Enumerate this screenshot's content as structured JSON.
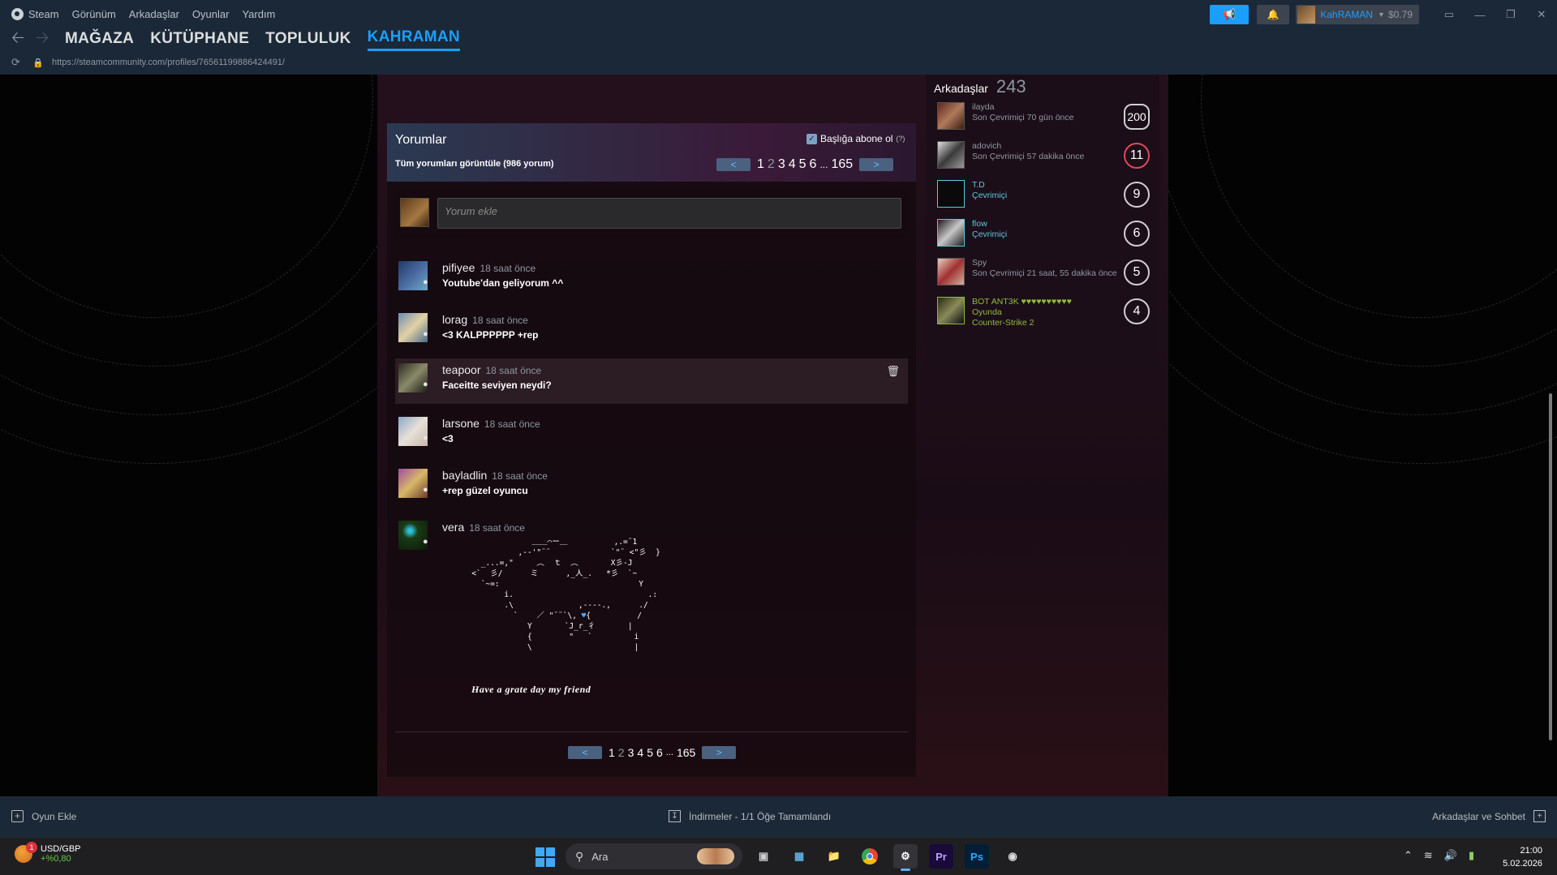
{
  "menu": {
    "steam": "Steam",
    "items": [
      "Görünüm",
      "Arkadaşlar",
      "Oyunlar",
      "Yardım"
    ]
  },
  "nav": {
    "tabs": [
      "MAĞAZA",
      "KÜTÜPHANE",
      "TOPLULUK",
      "KAHRAMAN"
    ]
  },
  "url": "https://steamcommunity.com/profiles/76561199886424491/",
  "account": {
    "name": "KahRAMAN",
    "balance": "$0.79"
  },
  "comments": {
    "title": "Yorumlar",
    "subscribe_label": "Başlığa abone ol",
    "subscribe_help": "(?)",
    "view_all": "Tüm yorumları görüntüle (986 yorum)",
    "pager": {
      "prev": "<",
      "next": ">",
      "pages": [
        "1",
        "2",
        "3",
        "4",
        "5",
        "6",
        "...",
        "165"
      ]
    },
    "add_placeholder": "Yorum ekle",
    "items": [
      {
        "author": "pifiyee",
        "time": "18 saat önce",
        "text": "Youtube'dan geliyorum ^^"
      },
      {
        "author": "lorag",
        "time": "18 saat önce",
        "text": "<3 KALPPPPPP +rep"
      },
      {
        "author": "teapoor",
        "time": "18 saat önce",
        "text": "Faceitte seviyen neydi?"
      },
      {
        "author": "larsone",
        "time": "18 saat önce",
        "text": "<3"
      },
      {
        "author": "bayladlin",
        "time": "18 saat önce",
        "text": "+rep güzel oyuncu"
      },
      {
        "author": "vera",
        "time": "18 saat önce",
        "text": "",
        "art_caption": "Have a grate day my friend"
      }
    ]
  },
  "friends": {
    "title": "Arkadaşlar",
    "count": "243",
    "items": [
      {
        "name": "ilayda",
        "status": "Son Çevrimiçi 70 gün önce",
        "game": "",
        "level": "200",
        "state": "offline"
      },
      {
        "name": "adovich",
        "status": "Son Çevrimiçi 57 dakika önce",
        "game": "",
        "level": "11",
        "state": "offline"
      },
      {
        "name": "T.D",
        "status": "Çevrimiçi",
        "game": "",
        "level": "9",
        "state": "online"
      },
      {
        "name": "flow",
        "status": "Çevrimiçi",
        "game": "",
        "level": "6",
        "state": "online"
      },
      {
        "name": "Spy",
        "status": "Son Çevrimiçi 21 saat, 55 dakika önce",
        "game": "",
        "level": "5",
        "state": "offline"
      },
      {
        "name": "BOT ANT3K ♥♥♥♥♥♥♥♥♥♥",
        "status": "Oyunda",
        "game": "Counter-Strike 2",
        "level": "4",
        "state": "ingame"
      }
    ]
  },
  "bottom": {
    "add_game": "Oyun Ekle",
    "downloads": "İndirmeler - 1/1 Öğe Tamamlandı",
    "friends_chat": "Arkadaşlar ve Sohbet"
  },
  "taskbar": {
    "weather_title": "USD/GBP",
    "weather_change": "+%0,80",
    "weather_badge": "1",
    "search_placeholder": "Ara",
    "time": "21:00",
    "date": "5.02.2026"
  }
}
